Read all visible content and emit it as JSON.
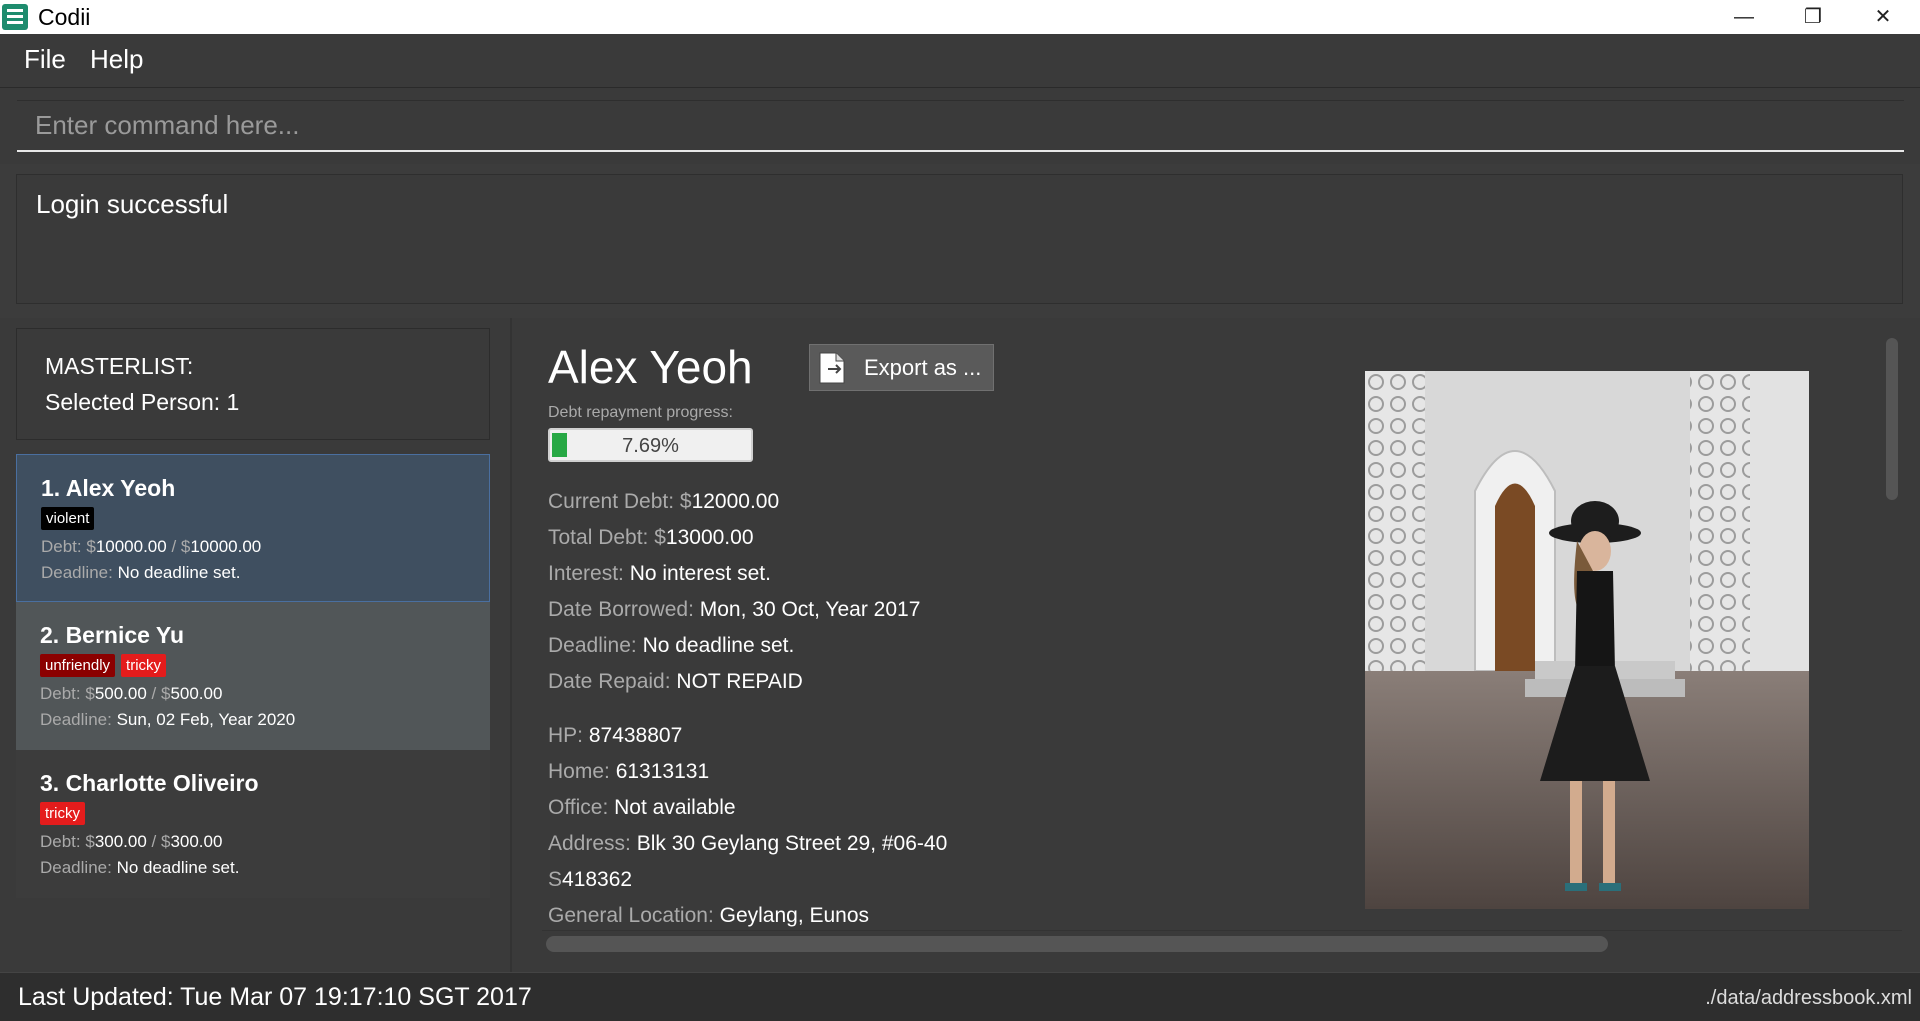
{
  "window": {
    "title": "Codii"
  },
  "menu": {
    "file": "File",
    "help": "Help"
  },
  "command": {
    "placeholder": "Enter command here...",
    "value": ""
  },
  "result": {
    "text": "Login successful"
  },
  "masterlist": {
    "label": "MASTERLIST:",
    "selected": "Selected Person: 1"
  },
  "persons": [
    {
      "name": "1.  Alex Yeoh",
      "tags": [
        "violent"
      ],
      "debt_label": "Debt: $",
      "debt_current": "10000.00",
      "debt_sep": " / $",
      "debt_total": "10000.00",
      "deadline_label": "Deadline: ",
      "deadline": "No deadline set."
    },
    {
      "name": "2.  Bernice Yu",
      "tags": [
        "unfriendly",
        "tricky"
      ],
      "debt_label": "Debt: $",
      "debt_current": "500.00",
      "debt_sep": " / $",
      "debt_total": "500.00",
      "deadline_label": "Deadline: ",
      "deadline": "Sun, 02 Feb, Year 2020"
    },
    {
      "name": "3.  Charlotte Oliveiro",
      "tags": [
        "tricky"
      ],
      "debt_label": "Debt: $",
      "debt_current": "300.00",
      "debt_sep": " / $",
      "debt_total": "300.00",
      "deadline_label": "Deadline: ",
      "deadline": "No deadline set."
    }
  ],
  "tag_colors": {
    "violent": "#000000",
    "unfriendly": "#8b0000",
    "tricky": "#e41c1c"
  },
  "detail": {
    "name": "Alex Yeoh",
    "export_label": "Export as ...",
    "progress_label": "Debt repayment progress:",
    "progress_text": "7.69%",
    "progress_fraction": 0.0769,
    "current_debt_label": "Current Debt: $",
    "current_debt": "12000.00",
    "total_debt_label": "Total Debt: $",
    "total_debt": "13000.00",
    "interest_label": "Interest: ",
    "interest": "No interest set.",
    "date_borrowed_label": "Date Borrowed: ",
    "date_borrowed": "Mon, 30 Oct, Year 2017",
    "deadline_label": "Deadline: ",
    "deadline": "No deadline set.",
    "date_repaid_label": "Date Repaid: ",
    "date_repaid": "NOT REPAID",
    "hp_label": "HP: ",
    "hp": "87438807",
    "home_label": "Home: ",
    "home": "61313131",
    "office_label": "Office: ",
    "office": "Not available",
    "address_label": "Address: ",
    "address": "Blk 30 Geylang Street 29, #06-40",
    "postal_prefix": "S",
    "postal": "418362",
    "location_label": "General Location: ",
    "location": "Geylang, Eunos"
  },
  "status": {
    "last_updated": "Last Updated: Tue Mar 07 19:17:10 SGT 2017",
    "path": "./data/addressbook.xml"
  },
  "colors": {
    "accent_green": "#27a844",
    "selected_card": "#3f4f60"
  }
}
